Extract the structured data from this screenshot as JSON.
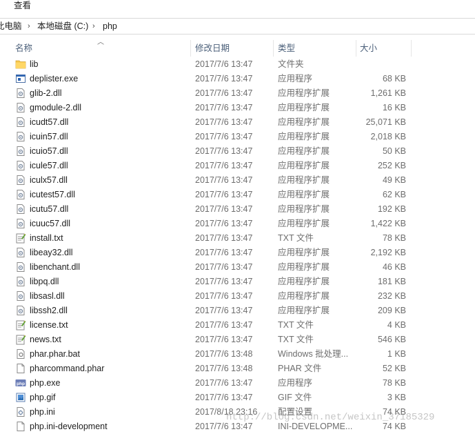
{
  "ribbon": {
    "view_tab": "查看"
  },
  "address_bar": {
    "crumbs": [
      "此电脑",
      "本地磁盘 (C:)",
      "php"
    ]
  },
  "columns": {
    "name": "名称",
    "date": "修改日期",
    "type": "类型",
    "size": "大小"
  },
  "files": [
    {
      "name": "lib",
      "date": "2017/7/6 13:47",
      "type": "文件夹",
      "size": "",
      "icon": "folder-icon"
    },
    {
      "name": "deplister.exe",
      "date": "2017/7/6 13:47",
      "type": "应用程序",
      "size": "68 KB",
      "icon": "exe-icon"
    },
    {
      "name": "glib-2.dll",
      "date": "2017/7/6 13:47",
      "type": "应用程序扩展",
      "size": "1,261 KB",
      "icon": "dll-icon"
    },
    {
      "name": "gmodule-2.dll",
      "date": "2017/7/6 13:47",
      "type": "应用程序扩展",
      "size": "16 KB",
      "icon": "dll-icon"
    },
    {
      "name": "icudt57.dll",
      "date": "2017/7/6 13:47",
      "type": "应用程序扩展",
      "size": "25,071 KB",
      "icon": "dll-icon"
    },
    {
      "name": "icuin57.dll",
      "date": "2017/7/6 13:47",
      "type": "应用程序扩展",
      "size": "2,018 KB",
      "icon": "dll-icon"
    },
    {
      "name": "icuio57.dll",
      "date": "2017/7/6 13:47",
      "type": "应用程序扩展",
      "size": "50 KB",
      "icon": "dll-icon"
    },
    {
      "name": "icule57.dll",
      "date": "2017/7/6 13:47",
      "type": "应用程序扩展",
      "size": "252 KB",
      "icon": "dll-icon"
    },
    {
      "name": "iculx57.dll",
      "date": "2017/7/6 13:47",
      "type": "应用程序扩展",
      "size": "49 KB",
      "icon": "dll-icon"
    },
    {
      "name": "icutest57.dll",
      "date": "2017/7/6 13:47",
      "type": "应用程序扩展",
      "size": "62 KB",
      "icon": "dll-icon"
    },
    {
      "name": "icutu57.dll",
      "date": "2017/7/6 13:47",
      "type": "应用程序扩展",
      "size": "192 KB",
      "icon": "dll-icon"
    },
    {
      "name": "icuuc57.dll",
      "date": "2017/7/6 13:47",
      "type": "应用程序扩展",
      "size": "1,422 KB",
      "icon": "dll-icon"
    },
    {
      "name": "install.txt",
      "date": "2017/7/6 13:47",
      "type": "TXT 文件",
      "size": "78 KB",
      "icon": "txt-icon"
    },
    {
      "name": "libeay32.dll",
      "date": "2017/7/6 13:47",
      "type": "应用程序扩展",
      "size": "2,192 KB",
      "icon": "dll-icon"
    },
    {
      "name": "libenchant.dll",
      "date": "2017/7/6 13:47",
      "type": "应用程序扩展",
      "size": "46 KB",
      "icon": "dll-icon"
    },
    {
      "name": "libpq.dll",
      "date": "2017/7/6 13:47",
      "type": "应用程序扩展",
      "size": "181 KB",
      "icon": "dll-icon"
    },
    {
      "name": "libsasl.dll",
      "date": "2017/7/6 13:47",
      "type": "应用程序扩展",
      "size": "232 KB",
      "icon": "dll-icon"
    },
    {
      "name": "libssh2.dll",
      "date": "2017/7/6 13:47",
      "type": "应用程序扩展",
      "size": "209 KB",
      "icon": "dll-icon"
    },
    {
      "name": "license.txt",
      "date": "2017/7/6 13:47",
      "type": "TXT 文件",
      "size": "4 KB",
      "icon": "txt-icon"
    },
    {
      "name": "news.txt",
      "date": "2017/7/6 13:47",
      "type": "TXT 文件",
      "size": "546 KB",
      "icon": "txt-icon"
    },
    {
      "name": "phar.phar.bat",
      "date": "2017/7/6 13:48",
      "type": "Windows 批处理...",
      "size": "1 KB",
      "icon": "bat-icon"
    },
    {
      "name": "pharcommand.phar",
      "date": "2017/7/6 13:48",
      "type": "PHAR 文件",
      "size": "52 KB",
      "icon": "blank-file-icon"
    },
    {
      "name": "php.exe",
      "date": "2017/7/6 13:47",
      "type": "应用程序",
      "size": "78 KB",
      "icon": "php-exe-icon"
    },
    {
      "name": "php.gif",
      "date": "2017/7/6 13:47",
      "type": "GIF 文件",
      "size": "3 KB",
      "icon": "gif-icon"
    },
    {
      "name": "php.ini",
      "date": "2017/8/18 23:16",
      "type": "配置设置",
      "size": "74 KB",
      "icon": "ini-icon"
    },
    {
      "name": "php.ini-development",
      "date": "2017/7/6 13:47",
      "type": "INI-DEVELOPME...",
      "size": "74 KB",
      "icon": "blank-file-icon"
    }
  ],
  "watermark": "http://blog.csdn.net/weixin_37185329",
  "colors": {
    "header_text": "#4c607a",
    "folder": "#f5c64b",
    "detail_text": "#6d6d6d"
  }
}
